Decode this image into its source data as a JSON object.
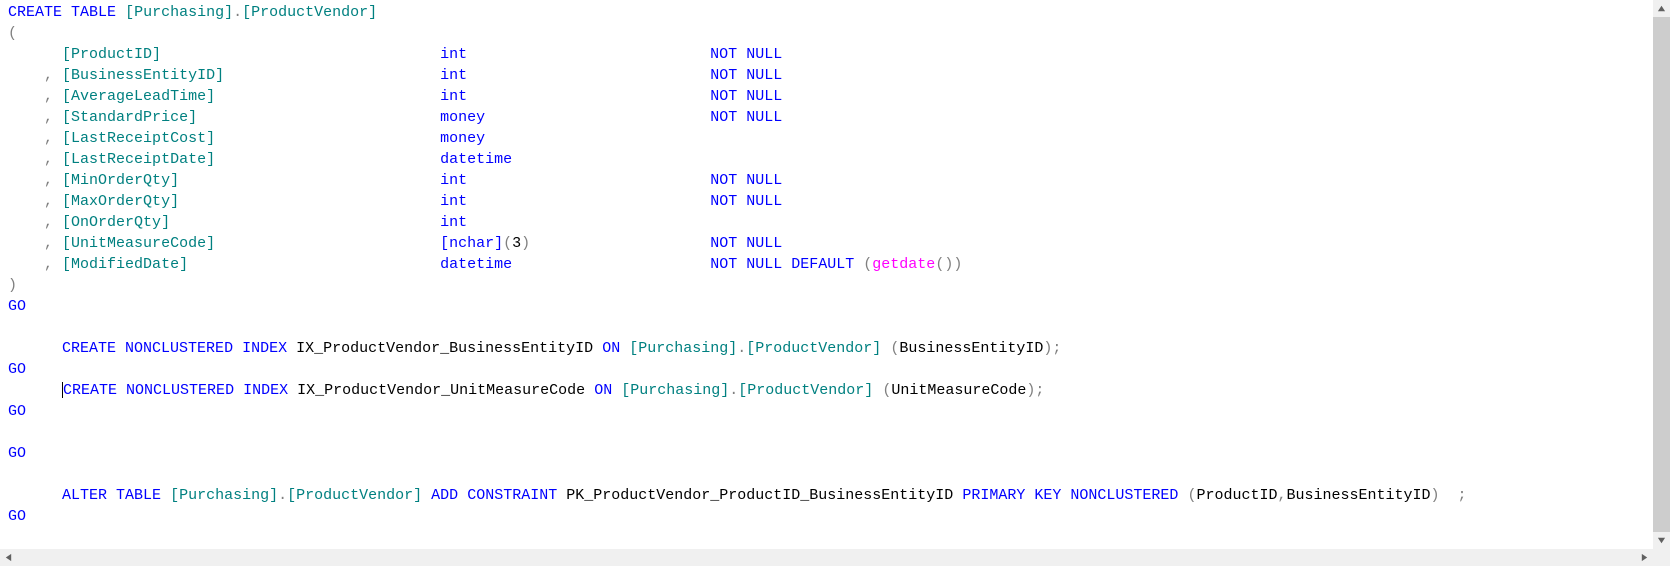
{
  "sql": {
    "create_table_stmt": "CREATE TABLE [Purchasing].[ProductVendor]",
    "open_paren": "(",
    "columns": [
      {
        "lead": "      ",
        "name": "[ProductID]",
        "type": "int",
        "constraint": "NOT NULL"
      },
      {
        "lead": "    , ",
        "name": "[BusinessEntityID]",
        "type": "int",
        "constraint": "NOT NULL"
      },
      {
        "lead": "    , ",
        "name": "[AverageLeadTime]",
        "type": "int",
        "constraint": "NOT NULL"
      },
      {
        "lead": "    , ",
        "name": "[StandardPrice]",
        "type": "money",
        "constraint": "NOT NULL"
      },
      {
        "lead": "    , ",
        "name": "[LastReceiptCost]",
        "type": "money",
        "constraint": ""
      },
      {
        "lead": "    , ",
        "name": "[LastReceiptDate]",
        "type": "datetime",
        "constraint": ""
      },
      {
        "lead": "    , ",
        "name": "[MinOrderQty]",
        "type": "int",
        "constraint": "NOT NULL"
      },
      {
        "lead": "    , ",
        "name": "[MaxOrderQty]",
        "type": "int",
        "constraint": "NOT NULL"
      },
      {
        "lead": "    , ",
        "name": "[OnOrderQty]",
        "type": "int",
        "constraint": ""
      },
      {
        "lead": "    , ",
        "name": "[UnitMeasureCode]",
        "type": "[nchar](3)",
        "constraint": "NOT NULL"
      },
      {
        "lead": "    , ",
        "name": "[ModifiedDate]",
        "type": "datetime",
        "constraint": "NOT NULL DEFAULT (getdate())"
      }
    ],
    "close_paren": ")",
    "go": "GO",
    "name_col_start": 6,
    "type_col_start": 48,
    "constraint_col_start": 78,
    "index1_indent": "      ",
    "index1": "CREATE NONCLUSTERED INDEX IX_ProductVendor_BusinessEntityID ON [Purchasing].[ProductVendor] (BusinessEntityID);",
    "index2_indent": "      ",
    "index2": "CREATE NONCLUSTERED INDEX IX_ProductVendor_UnitMeasureCode ON [Purchasing].[ProductVendor] (UnitMeasureCode);",
    "alter_indent": "      ",
    "alter": "ALTER TABLE [Purchasing].[ProductVendor] ADD CONSTRAINT PK_ProductVendor_ProductID_BusinessEntityID PRIMARY KEY NONCLUSTERED (ProductID,BusinessEntityID)  ;"
  },
  "caret_line": 18,
  "caret_col": 6
}
